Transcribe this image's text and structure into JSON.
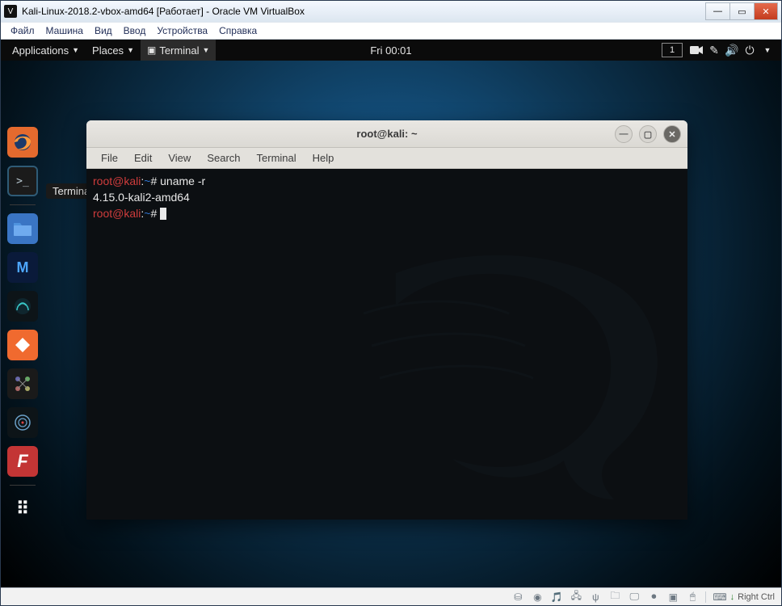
{
  "window": {
    "title": "Kali-Linux-2018.2-vbox-amd64 [Работает] - Oracle VM VirtualBox",
    "menu": {
      "file": "Файл",
      "machine": "Машина",
      "view": "Вид",
      "input": "Ввод",
      "devices": "Устройства",
      "help": "Справка"
    }
  },
  "gnome": {
    "applications": "Applications",
    "places": "Places",
    "terminal": "Terminal",
    "clock": "Fri 00:01",
    "workspace": "1"
  },
  "dock": {
    "tooltip": "Terminal"
  },
  "terminal": {
    "title": "root@kali: ~",
    "menu": {
      "file": "File",
      "edit": "Edit",
      "view": "View",
      "search": "Search",
      "terminal": "Terminal",
      "help": "Help"
    },
    "line1": {
      "user": "root",
      "at": "@",
      "host": "kali",
      "colon": ":",
      "path": "~",
      "hash": "# ",
      "cmd": "uname -r"
    },
    "line2": "4.15.0-kali2-amd64",
    "line3": {
      "user": "root",
      "at": "@",
      "host": "kali",
      "colon": ":",
      "path": "~",
      "hash": "# "
    }
  },
  "statusbar": {
    "hostkey": "Right Ctrl"
  }
}
